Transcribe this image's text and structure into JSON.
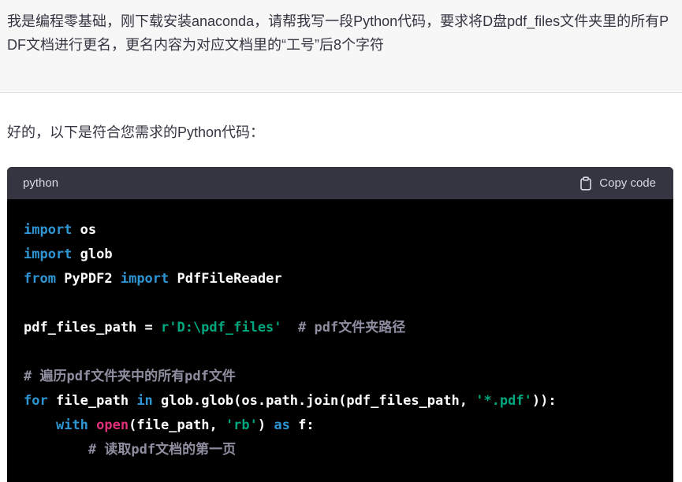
{
  "user_message": {
    "text": "我是编程零基础，刚下载安装anaconda，请帮我写一段Python代码，要求将D盘pdf_files文件夹里的所有PDF文档进行更名，更名内容为对应文档里的“工号”后8个字符"
  },
  "assistant_message": {
    "intro": "好的，以下是符合您需求的Python代码："
  },
  "code_block": {
    "language": "python",
    "copy_label": "Copy code",
    "copy_icon": "clipboard-icon",
    "lines": [
      [
        {
          "t": "kw",
          "v": "import"
        },
        {
          "t": "plain",
          "v": " os"
        }
      ],
      [
        {
          "t": "kw",
          "v": "import"
        },
        {
          "t": "plain",
          "v": " glob"
        }
      ],
      [
        {
          "t": "kw",
          "v": "from"
        },
        {
          "t": "plain",
          "v": " PyPDF2 "
        },
        {
          "t": "kw",
          "v": "import"
        },
        {
          "t": "plain",
          "v": " PdfFileReader"
        }
      ],
      [],
      [
        {
          "t": "plain",
          "v": "pdf_files_path = "
        },
        {
          "t": "str",
          "v": "r'D:\\pdf_files'"
        },
        {
          "t": "plain",
          "v": "  "
        },
        {
          "t": "cm",
          "v": "# pdf文件夹路径"
        }
      ],
      [],
      [
        {
          "t": "cm",
          "v": "# 遍历pdf文件夹中的所有pdf文件"
        }
      ],
      [
        {
          "t": "kw",
          "v": "for"
        },
        {
          "t": "plain",
          "v": " file_path "
        },
        {
          "t": "kw",
          "v": "in"
        },
        {
          "t": "plain",
          "v": " glob.glob(os.path.join(pdf_files_path, "
        },
        {
          "t": "str",
          "v": "'*.pdf'"
        },
        {
          "t": "plain",
          "v": ")):"
        }
      ],
      [
        {
          "t": "plain",
          "v": "    "
        },
        {
          "t": "kw",
          "v": "with"
        },
        {
          "t": "plain",
          "v": " "
        },
        {
          "t": "fn",
          "v": "open"
        },
        {
          "t": "plain",
          "v": "(file_path, "
        },
        {
          "t": "str",
          "v": "'rb'"
        },
        {
          "t": "plain",
          "v": ") "
        },
        {
          "t": "kw",
          "v": "as"
        },
        {
          "t": "plain",
          "v": " f:"
        }
      ],
      [
        {
          "t": "plain",
          "v": "        "
        },
        {
          "t": "cm",
          "v": "# 读取pdf文档的第一页"
        }
      ]
    ]
  },
  "colors": {
    "keyword": "#2e95d3",
    "string": "#00a67d",
    "builtin": "#df3079",
    "comment": "#8e8ea0",
    "code_bg": "#000000",
    "code_header_bg": "#343541",
    "user_bg": "#f7f7f8"
  }
}
